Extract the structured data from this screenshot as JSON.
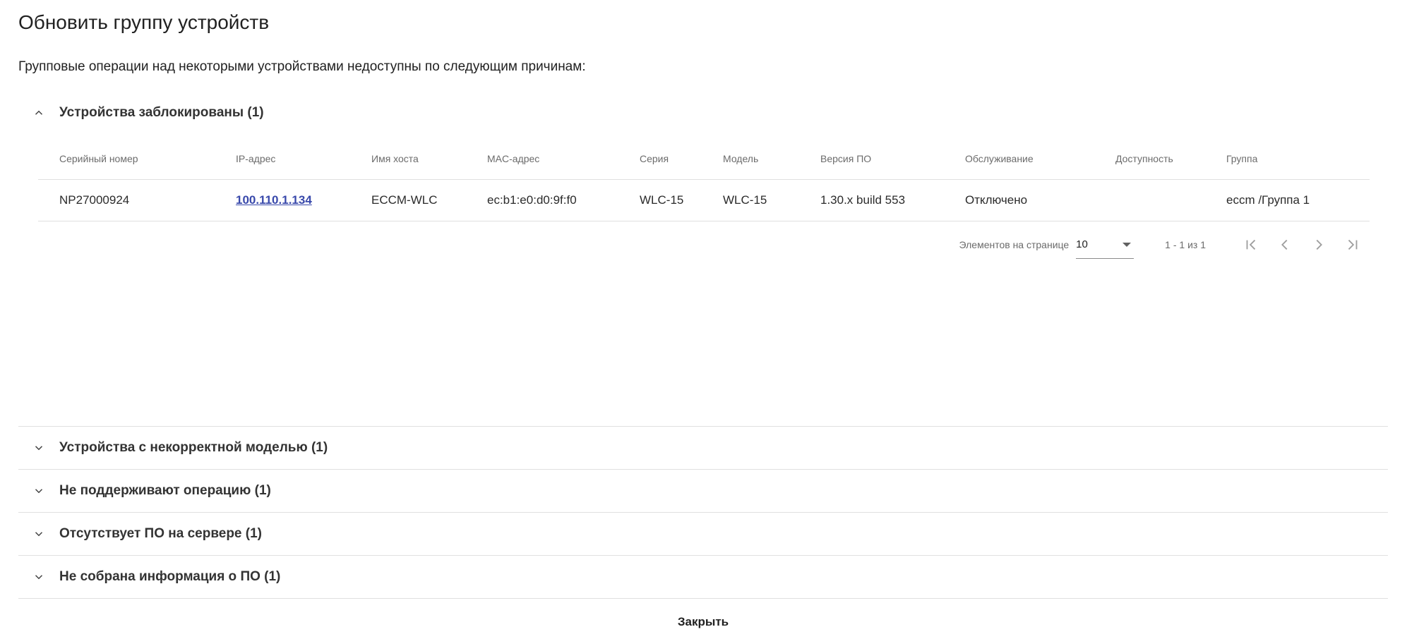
{
  "dialog": {
    "title": "Обновить группу устройств",
    "subtitle": "Групповые операции над некоторыми устройствами недоступны по следующим причинам:"
  },
  "locked_panel": {
    "title": "Устройства заблокированы (1)",
    "columns": [
      "Серийный номер",
      "IP-адрес",
      "Имя хоста",
      "MAC-адрес",
      "Серия",
      "Модель",
      "Версия ПО",
      "Обслуживание",
      "Доступность",
      "Группа"
    ],
    "rows": [
      {
        "serial": "NP27000924",
        "ip": "100.110.1.134",
        "hostname": "ECCM-WLC",
        "mac": "ec:b1:e0:d0:9f:f0",
        "series": "WLC-15",
        "model": "WLC-15",
        "firmware": "1.30.x build 553",
        "maintenance": "Отключено",
        "availability": "",
        "group": "eccm /Группа 1"
      }
    ],
    "paginator": {
      "items_per_page_label": "Элементов на странице",
      "page_size": "10",
      "range": "1 - 1 из 1"
    }
  },
  "sections": [
    {
      "title": "Устройства с некорректной моделью (1)"
    },
    {
      "title": "Не поддерживают операцию (1)"
    },
    {
      "title": "Отсутствует ПО на сервере (1)"
    },
    {
      "title": "Не собрана информация о ПО (1)"
    }
  ],
  "footer": {
    "close_label": "Закрыть"
  }
}
